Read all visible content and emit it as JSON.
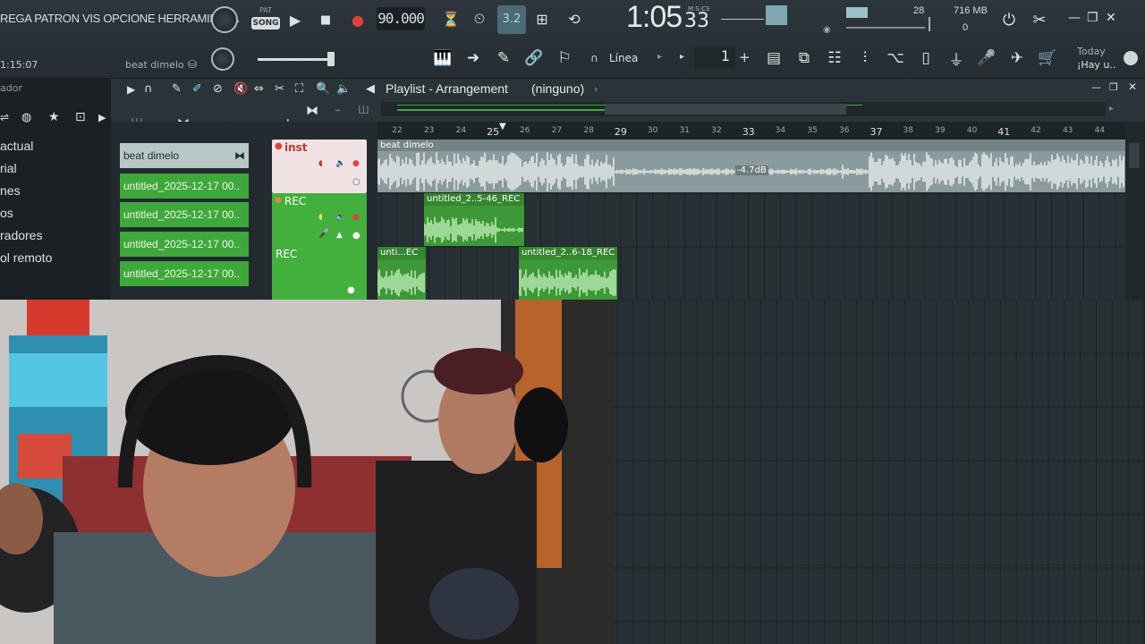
{
  "menu": {
    "text": "REGA PATRON  VIS OPCIONE HERRAMIENTA"
  },
  "status": {
    "time_left": "1:15:07",
    "hint": "beat dimelo"
  },
  "transport": {
    "pat_label": "PAT",
    "song_label": "SONG",
    "tempo": "90.000",
    "time_main": "1:05",
    "time_secs": "33",
    "mscs_label": "M:S:CS",
    "pattern_number": "1",
    "snap_mode": "Línea"
  },
  "cpu": {
    "value": "28",
    "memory": "716 MB",
    "voices": "0"
  },
  "news": {
    "day": "Today",
    "text": "¡Hay u.."
  },
  "browser": {
    "title": "ador",
    "items": [
      "actual",
      "rial",
      "nes",
      "os",
      "radores",
      "ol remoto"
    ]
  },
  "playlist": {
    "title": "Playlist - Arrangement",
    "pattern": "(ninguno)"
  },
  "channels": [
    "beat dimelo",
    "untitled_2025-12-17 00..",
    "untitled_2025-12-17 00..",
    "untitled_2025-12-17 00..",
    "untitled_2025-12-17 00.."
  ],
  "tracks": [
    {
      "name": "inst",
      "color": "#f1e3e3"
    },
    {
      "name": "REC",
      "color": "#43b03d"
    },
    {
      "name": "REC",
      "color": "#43b03d"
    }
  ],
  "ruler": [
    "22",
    "23",
    "24",
    "25",
    "26",
    "27",
    "28",
    "29",
    "30",
    "31",
    "32",
    "33",
    "34",
    "35",
    "36",
    "37",
    "38",
    "39",
    "40",
    "41",
    "42",
    "43",
    "44"
  ],
  "clips": {
    "inst": "beat dimelo",
    "gain": "-4.7dB",
    "rec1": "untitled_2..5-46_REC",
    "rec2a": "unti...EC",
    "rec2b": "untitled_2..6-18_REC"
  },
  "colors": {
    "accent_green": "#3fa83a",
    "record_red": "#e0413b",
    "panel": "#263035"
  }
}
